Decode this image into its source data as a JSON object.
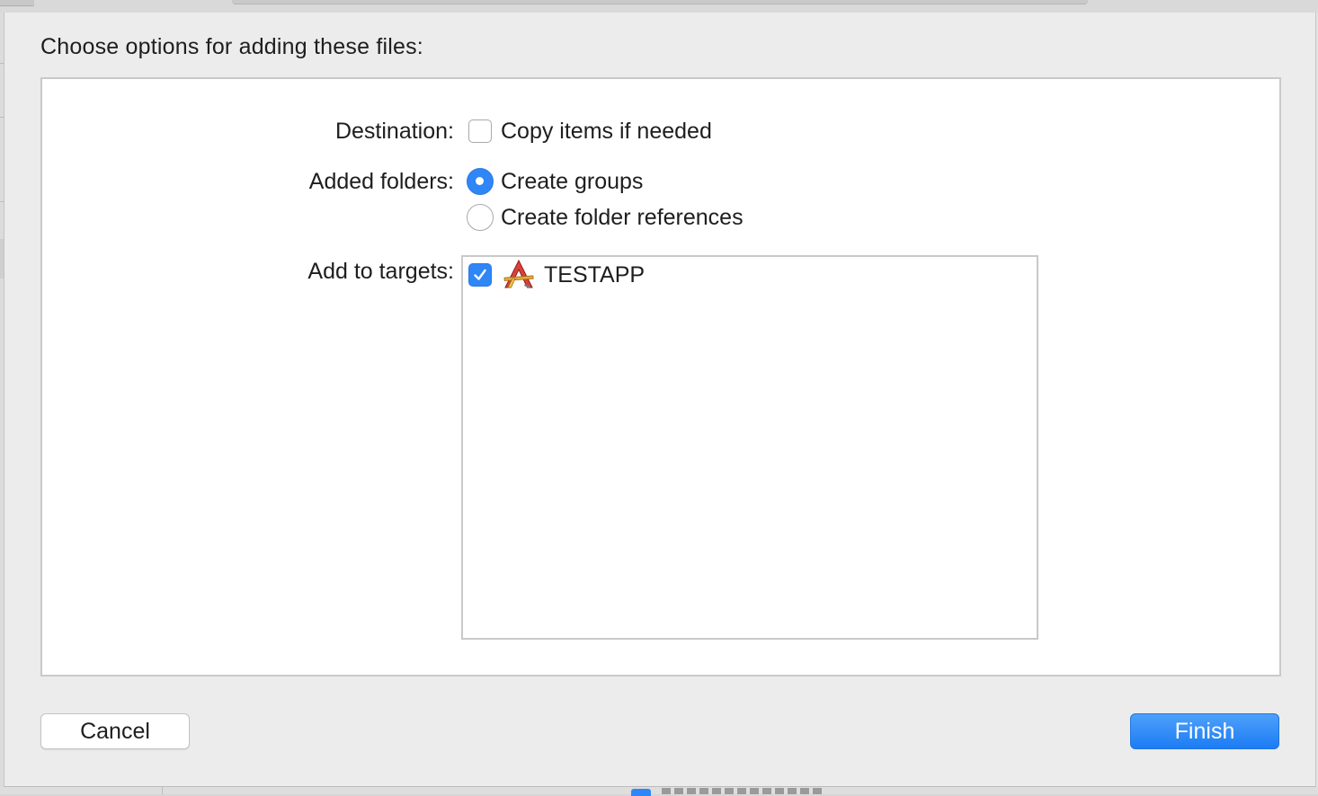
{
  "dialog": {
    "title": "Choose options for adding these files:",
    "destination": {
      "label": "Destination:",
      "option_label": "Copy items if needed",
      "checked": false
    },
    "added_folders": {
      "label": "Added folders:",
      "options": [
        {
          "label": "Create groups",
          "selected": true
        },
        {
          "label": "Create folder references",
          "selected": false
        }
      ]
    },
    "add_to_targets": {
      "label": "Add to targets:",
      "targets": [
        {
          "name": "TESTAPP",
          "checked": true,
          "icon": "app-target-icon"
        }
      ]
    },
    "buttons": {
      "cancel_label": "Cancel",
      "finish_label": "Finish"
    }
  },
  "colors": {
    "accent": "#2f86f6",
    "sheet_background": "#ececec",
    "panel_background": "#ffffff"
  }
}
